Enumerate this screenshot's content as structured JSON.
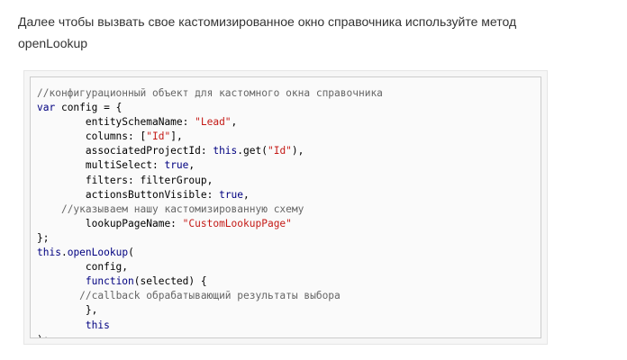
{
  "intro": {
    "line1": "Далее чтобы вызвать свое кастомизированное окно справочника используйте метод",
    "line2": "openLookup"
  },
  "code": {
    "lines": [
      [
        {
          "t": "cm",
          "v": "//конфигурационный объект для кастомного окна справочника"
        }
      ],
      [
        {
          "t": "kw",
          "v": "var"
        },
        {
          "t": "pl",
          "v": " config = {"
        }
      ],
      [
        {
          "t": "pl",
          "v": "        entitySchemaName: "
        },
        {
          "t": "str",
          "v": "\"Lead\""
        },
        {
          "t": "pl",
          "v": ","
        }
      ],
      [
        {
          "t": "pl",
          "v": "        columns: ["
        },
        {
          "t": "str",
          "v": "\"Id\""
        },
        {
          "t": "pl",
          "v": "],"
        }
      ],
      [
        {
          "t": "pl",
          "v": "        associatedProjectId: "
        },
        {
          "t": "kw",
          "v": "this"
        },
        {
          "t": "pl",
          "v": ".get("
        },
        {
          "t": "str",
          "v": "\"Id\""
        },
        {
          "t": "pl",
          "v": "),"
        }
      ],
      [
        {
          "t": "pl",
          "v": "        multiSelect: "
        },
        {
          "t": "kw",
          "v": "true"
        },
        {
          "t": "pl",
          "v": ","
        }
      ],
      [
        {
          "t": "pl",
          "v": "        filters: filterGroup,"
        }
      ],
      [
        {
          "t": "pl",
          "v": "        actionsButtonVisible: "
        },
        {
          "t": "kw",
          "v": "true"
        },
        {
          "t": "pl",
          "v": ","
        }
      ],
      [
        {
          "t": "pl",
          "v": "    "
        },
        {
          "t": "cm",
          "v": "//указываем нашу кастомизированную схему"
        }
      ],
      [
        {
          "t": "pl",
          "v": "        lookupPageName: "
        },
        {
          "t": "str",
          "v": "\"CustomLookupPage\""
        }
      ],
      [
        {
          "t": "pl",
          "v": "};"
        }
      ],
      [
        {
          "t": "kw",
          "v": "this"
        },
        {
          "t": "pl",
          "v": "."
        },
        {
          "t": "kw",
          "v": "openLookup"
        },
        {
          "t": "pl",
          "v": "("
        }
      ],
      [
        {
          "t": "pl",
          "v": "        config,"
        }
      ],
      [
        {
          "t": "pl",
          "v": "        "
        },
        {
          "t": "kw",
          "v": "function"
        },
        {
          "t": "pl",
          "v": "(selected) {"
        }
      ],
      [
        {
          "t": "pl",
          "v": "       "
        },
        {
          "t": "cm",
          "v": "//callback обрабатывающий результаты выбора"
        }
      ],
      [
        {
          "t": "pl",
          "v": "        },"
        }
      ],
      [
        {
          "t": "pl",
          "v": "        "
        },
        {
          "t": "kw",
          "v": "this"
        }
      ],
      [
        {
          "t": "pl",
          "v": ");"
        }
      ]
    ]
  }
}
